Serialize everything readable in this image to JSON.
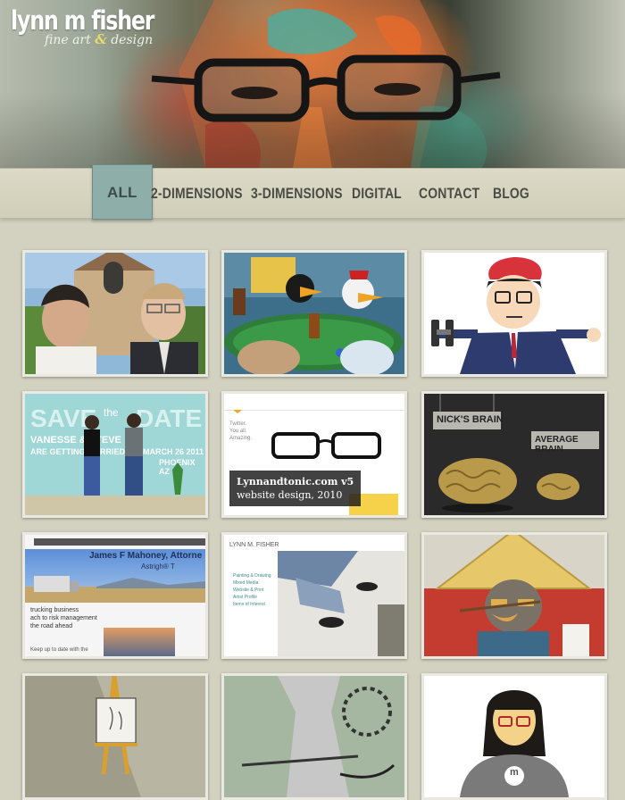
{
  "brand": {
    "name": "lynn m fisher",
    "tagline_a": "fine art",
    "tagline_amp": "&",
    "tagline_b": "design"
  },
  "nav": [
    {
      "label": "ALL",
      "active": true
    },
    {
      "label": "2-DIMENSIONS"
    },
    {
      "label": "3-DIMENSIONS"
    },
    {
      "label": "DIGITAL"
    },
    {
      "label": "CONTACT"
    },
    {
      "label": "BLOG"
    }
  ],
  "portfolio": {
    "save_date": {
      "save": "SAVE",
      "the": "the",
      "date": "DATE",
      "names": "VANESSE & STEVE",
      "line2": "ARE GETTING MARRIED",
      "when": "MARCH 26 2011",
      "where": "PHOENIX AZ"
    },
    "nicks_brain": {
      "sign1": "NICK'S BRAIN",
      "sign2": "AVERAGE BRAIN"
    },
    "lynnandtonic": {
      "caption_title": "Lynnandtonic.com v5",
      "caption_sub": "website design, 2010",
      "tweet": "Twitter. You all. Amazing."
    },
    "mahoney": {
      "title": "James F Mahoney, Attorne",
      "subtitle": "Astrigh® T",
      "text1": "trucking business",
      "text2": "ach to risk management",
      "text3": "the road ahead",
      "text4": "Keep up to date with the"
    },
    "lmf_site": {
      "header": "LYNN M. FISHER",
      "links": [
        "Painting & Drawing",
        "Mixed Media",
        "Website & Print",
        "Artist Profile",
        "Items of Interest"
      ]
    },
    "hoodie": {
      "badge": "m"
    }
  }
}
